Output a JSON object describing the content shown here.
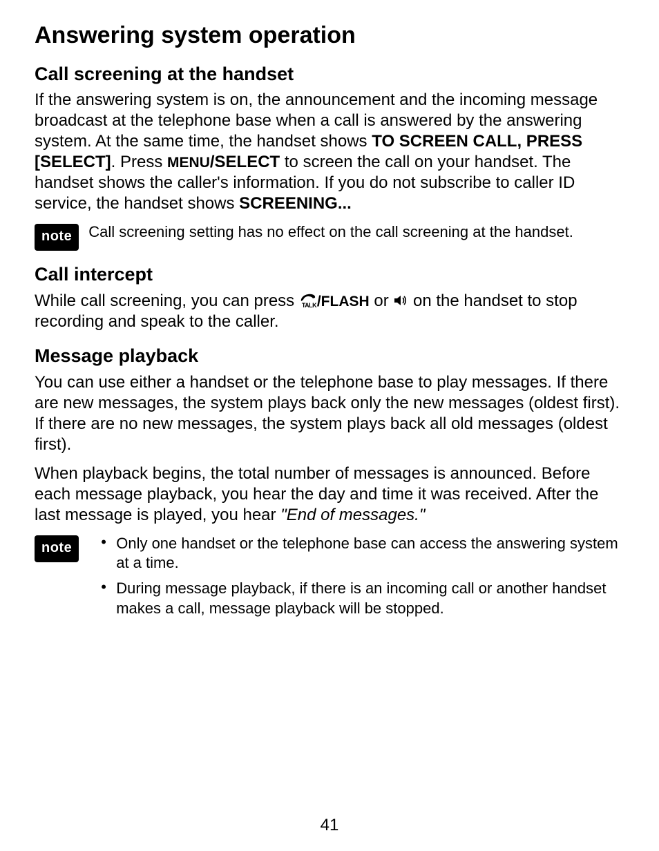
{
  "title": "Answering system operation",
  "sections": {
    "s1": {
      "heading": "Call screening at the handset",
      "body_pre": "If the answering system is on, the announcement and the incoming message broadcast at the telephone base when a call is answered by the answering system. At the same time, the handset shows ",
      "bold1": "TO SCREEN CALL, PRESS [SELECT]",
      "body_mid1": ". Press ",
      "sc1": "MENU",
      "bold2": "/SELECT",
      "body_mid2": " to screen the call on your handset. The handset shows the caller's information. If you do not subscribe to caller ID service, the handset shows ",
      "bold3": "SCREENING..."
    },
    "note1": {
      "label": "note",
      "text": "Call screening setting has no effect on the call screening at the handset."
    },
    "s2": {
      "heading": "Call intercept",
      "body_pre": "While call screening, you can press ",
      "flash": "/FLASH",
      "body_mid": " or ",
      "body_post": " on the handset to stop recording and speak to the caller."
    },
    "s3": {
      "heading": "Message playback",
      "p1": "You can use either a handset or the telephone base to play messages. If there are new messages, the system plays back only the new messages (oldest first). If there are no new messages, the system plays back all old messages (oldest first).",
      "p2_pre": "When playback begins, the total number of messages is announced. Before each message playback, you hear the day and time it was received. After the last message is played, you hear ",
      "p2_italic": "\"End of messages.\""
    },
    "note2": {
      "label": "note",
      "items": [
        "Only one handset or the telephone base can access the answering system at a time.",
        "During message playback, if there is an incoming call or another handset makes a call, message playback will be stopped."
      ]
    }
  },
  "page_number": "41",
  "icons": {
    "talk_sub": "TALK"
  }
}
